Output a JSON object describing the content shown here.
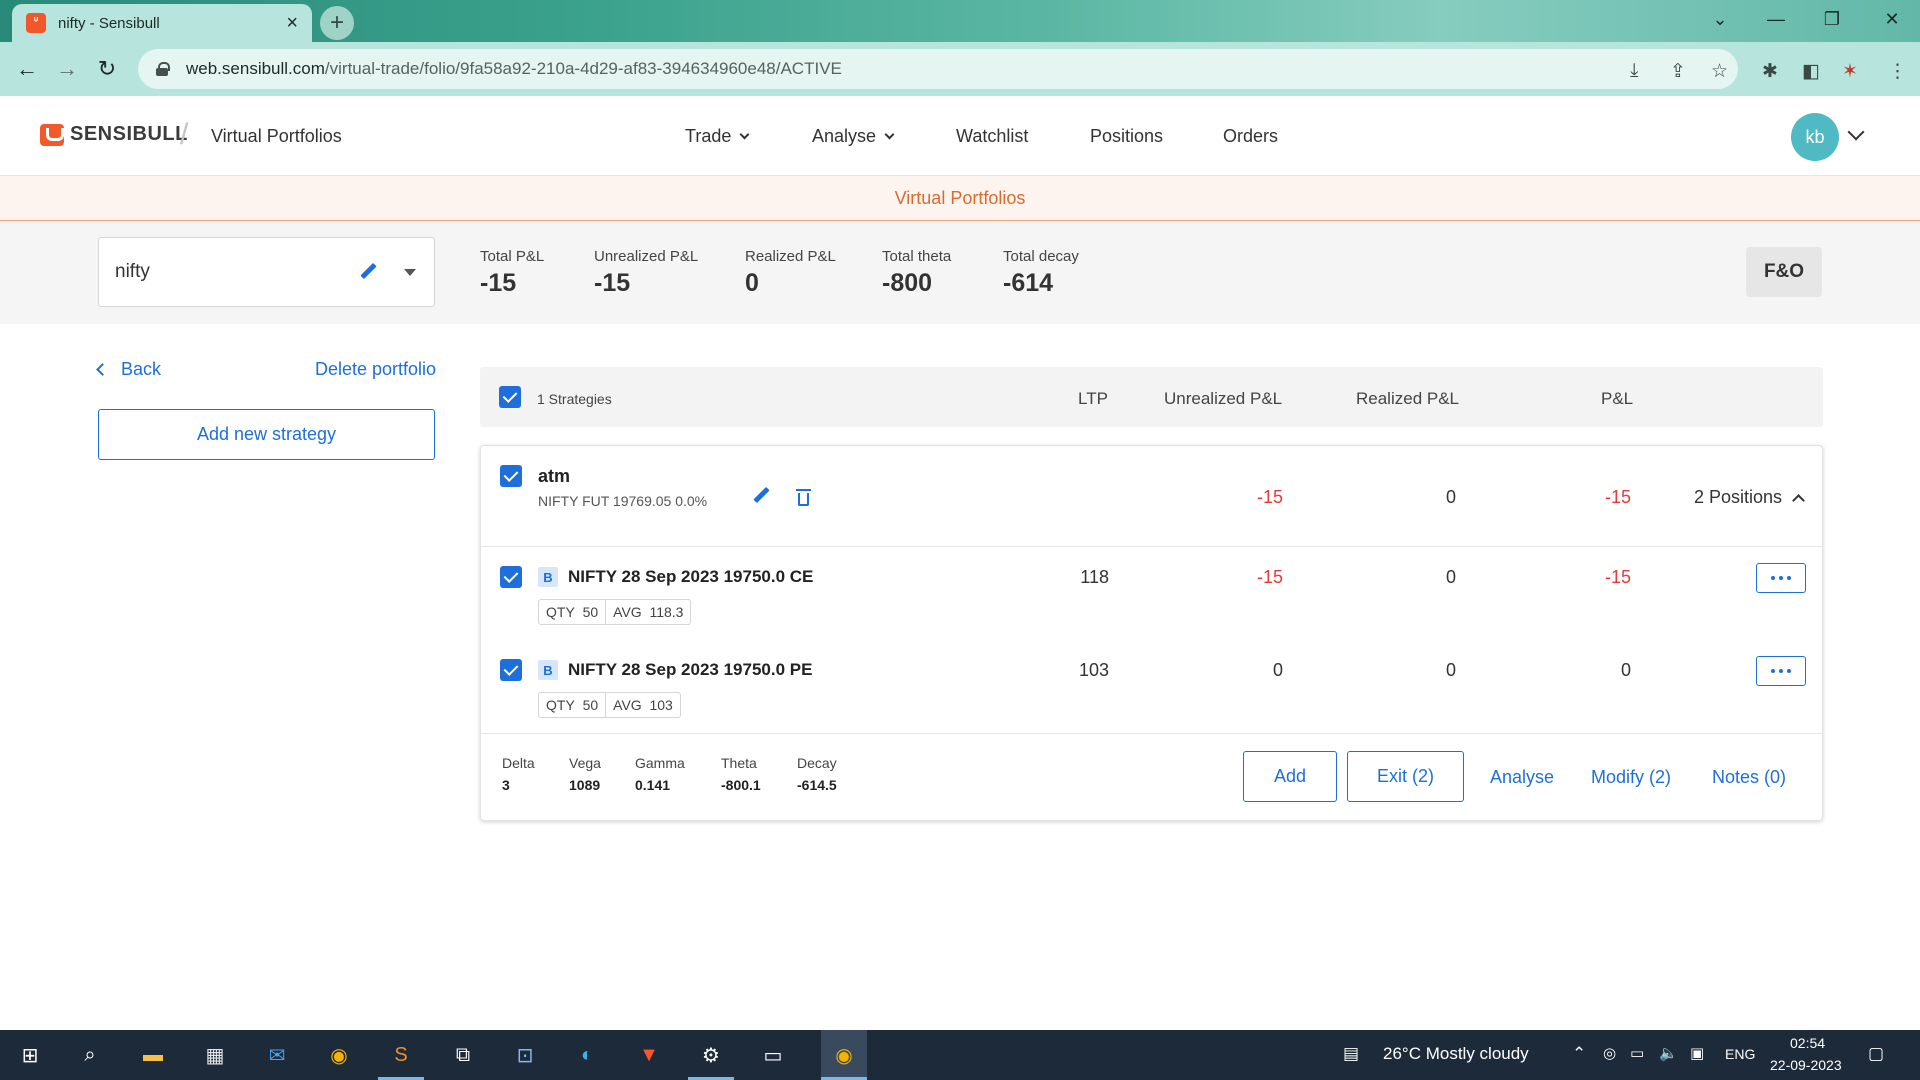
{
  "browser": {
    "tab_title": "nifty - Sensibull",
    "url_host": "web.sensibull.com",
    "url_path": "/virtual-trade/folio/9fa58a92-210a-4d29-af83-394634960e48/ACTIVE"
  },
  "header": {
    "logo": "SENSIBULL",
    "app_title": "Virtual Portfolios",
    "nav": {
      "trade": "Trade",
      "analyse": "Analyse",
      "watchlist": "Watchlist",
      "positions": "Positions",
      "orders": "Orders"
    },
    "avatar": "kb"
  },
  "banner": "Virtual Portfolios",
  "summary": {
    "folio_name": "nifty",
    "metrics": [
      {
        "label": "Total P&L",
        "value": "-15"
      },
      {
        "label": "Unrealized P&L",
        "value": "-15"
      },
      {
        "label": "Realized P&L",
        "value": "0"
      },
      {
        "label": "Total theta",
        "value": "-800"
      },
      {
        "label": "Total decay",
        "value": "-614"
      }
    ],
    "segment_button": "F&O"
  },
  "sidebar": {
    "back": "Back",
    "delete": "Delete portfolio",
    "add_strategy": "Add new strategy"
  },
  "table": {
    "header": {
      "strategies": "1 Strategies",
      "ltp": "LTP",
      "unrealized": "Unrealized P&L",
      "realized": "Realized P&L",
      "pnl": "P&L"
    },
    "strategy": {
      "name": "atm",
      "underlying": "NIFTY FUT 19769.05 0.0%",
      "unrealized": "-15",
      "realized": "0",
      "pnl": "-15",
      "positions_toggle": "2 Positions"
    },
    "legs": [
      {
        "side": "B",
        "name": "NIFTY 28 Sep 2023 19750.0 CE",
        "qty_label": "QTY",
        "qty": "50",
        "avg_label": "AVG",
        "avg": "118.3",
        "ltp": "118",
        "unrealized": "-15",
        "realized": "0",
        "pnl": "-15"
      },
      {
        "side": "B",
        "name": "NIFTY 28 Sep 2023 19750.0 PE",
        "qty_label": "QTY",
        "qty": "50",
        "avg_label": "AVG",
        "avg": "103",
        "ltp": "103",
        "unrealized": "0",
        "realized": "0",
        "pnl": "0"
      }
    ],
    "greeks": [
      {
        "label": "Delta",
        "value": "3"
      },
      {
        "label": "Vega",
        "value": "1089"
      },
      {
        "label": "Gamma",
        "value": "0.141"
      },
      {
        "label": "Theta",
        "value": "-800.1"
      },
      {
        "label": "Decay",
        "value": "-614.5"
      }
    ],
    "actions": {
      "add": "Add",
      "exit": "Exit (2)",
      "analyse": "Analyse",
      "modify": "Modify (2)",
      "notes": "Notes (0)"
    }
  },
  "taskbar": {
    "weather": "26°C  Mostly cloudy",
    "lang": "ENG",
    "time": "02:54",
    "date": "22-09-2023"
  },
  "colors": {
    "accent": "#1e6fd9",
    "negative": "#e23b3b",
    "banner_text": "#d96b2c",
    "brand": "#f25a29"
  }
}
